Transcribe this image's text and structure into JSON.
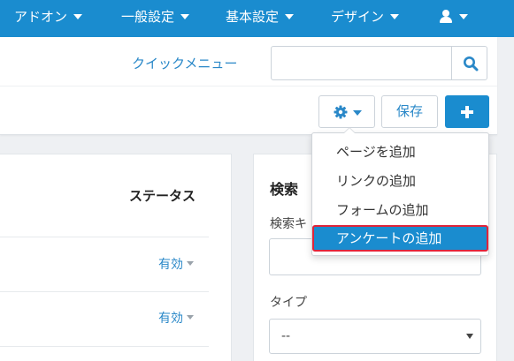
{
  "nav": {
    "items": [
      {
        "label": "アドオン"
      },
      {
        "label": "一般設定"
      },
      {
        "label": "基本設定"
      },
      {
        "label": "デザイン"
      }
    ],
    "user_icon": "user-icon"
  },
  "header": {
    "quick_menu": "クイックメニュー",
    "search_placeholder": "",
    "save_label": "保存",
    "gear_icon": "gear-icon",
    "add_icon": "plus-icon"
  },
  "dropdown": {
    "items": [
      {
        "label": "ページを追加"
      },
      {
        "label": "リンクの追加"
      },
      {
        "label": "フォームの追加"
      },
      {
        "label": "アンケートの追加"
      }
    ],
    "highlighted_index": 3
  },
  "table": {
    "status_header": "ステータス",
    "rows": [
      {
        "status": "有効"
      },
      {
        "status": "有効"
      }
    ]
  },
  "search_panel": {
    "title": "検索",
    "keyword_label": "検索キ",
    "keyword_value": "",
    "type_label": "タイプ",
    "type_value": "--"
  },
  "colors": {
    "primary": "#1a8ccf",
    "link": "#2a88c8",
    "highlight_outline": "#e0243a"
  }
}
